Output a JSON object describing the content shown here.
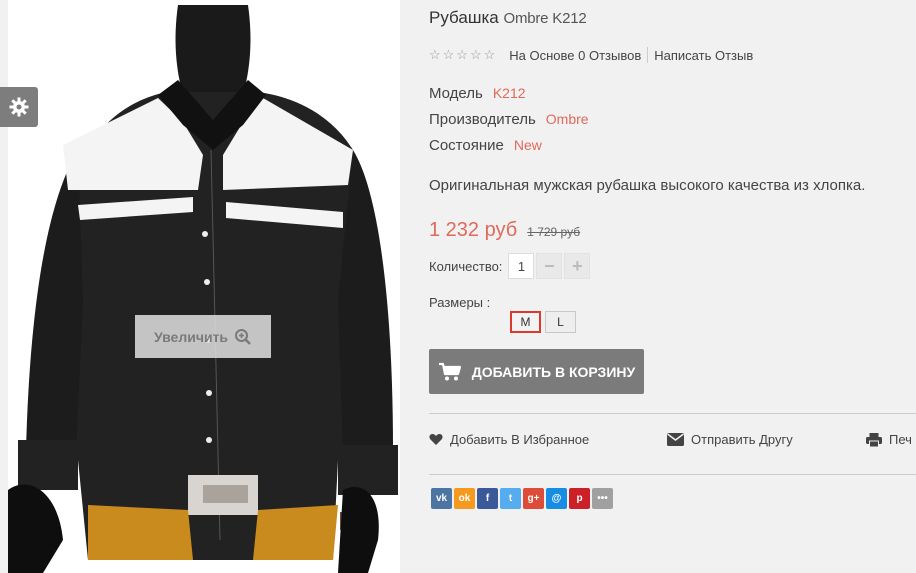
{
  "product": {
    "title": "Рубашка",
    "brand_model": "Ombre K212",
    "rating": {
      "stars": "☆☆☆☆☆",
      "reviews_text": "На Основе 0 Отзывов",
      "write_review": "Написать Отзыв"
    },
    "meta": [
      {
        "label": "Модель",
        "value": "K212"
      },
      {
        "label": "Производитель",
        "value": "Ombre"
      },
      {
        "label": "Состояние",
        "value": "New"
      }
    ],
    "description": "Оригинальная мужская рубашка высокого качества из хлопка.",
    "price": "1 232 руб",
    "old_price": "1 729 руб",
    "quantity": {
      "label": "Количество:",
      "value": "1",
      "minus": "−",
      "plus": "+"
    },
    "sizes": {
      "label": "Размеры :",
      "options": [
        "M",
        "L"
      ],
      "selected": "M"
    },
    "add_to_cart": "ДОБАВИТЬ В КОРЗИНУ"
  },
  "image": {
    "zoom_label": "Увеличить"
  },
  "actions": {
    "wishlist": "Добавить В Избранное",
    "send_friend": "Отправить Другу",
    "print": "Печ"
  },
  "share": [
    {
      "icon": "vk-icon",
      "glyph": "vk",
      "color": "#4c75a3"
    },
    {
      "icon": "odnoklassniki-icon",
      "glyph": "ok",
      "color": "#f59a1f"
    },
    {
      "icon": "facebook-icon",
      "glyph": "f",
      "color": "#3b5998"
    },
    {
      "icon": "twitter-icon",
      "glyph": "t",
      "color": "#55acee"
    },
    {
      "icon": "google-plus-icon",
      "glyph": "g+",
      "color": "#dd4b39"
    },
    {
      "icon": "mail-icon",
      "glyph": "@",
      "color": "#168de2"
    },
    {
      "icon": "pinterest-icon",
      "glyph": "p",
      "color": "#cb2027"
    },
    {
      "icon": "more-icon",
      "glyph": "•••",
      "color": "#a0a0a0"
    }
  ],
  "colors": {
    "accent": "#e06a5a",
    "button": "#7b7b7b",
    "selected_size": "#d93a2b"
  }
}
